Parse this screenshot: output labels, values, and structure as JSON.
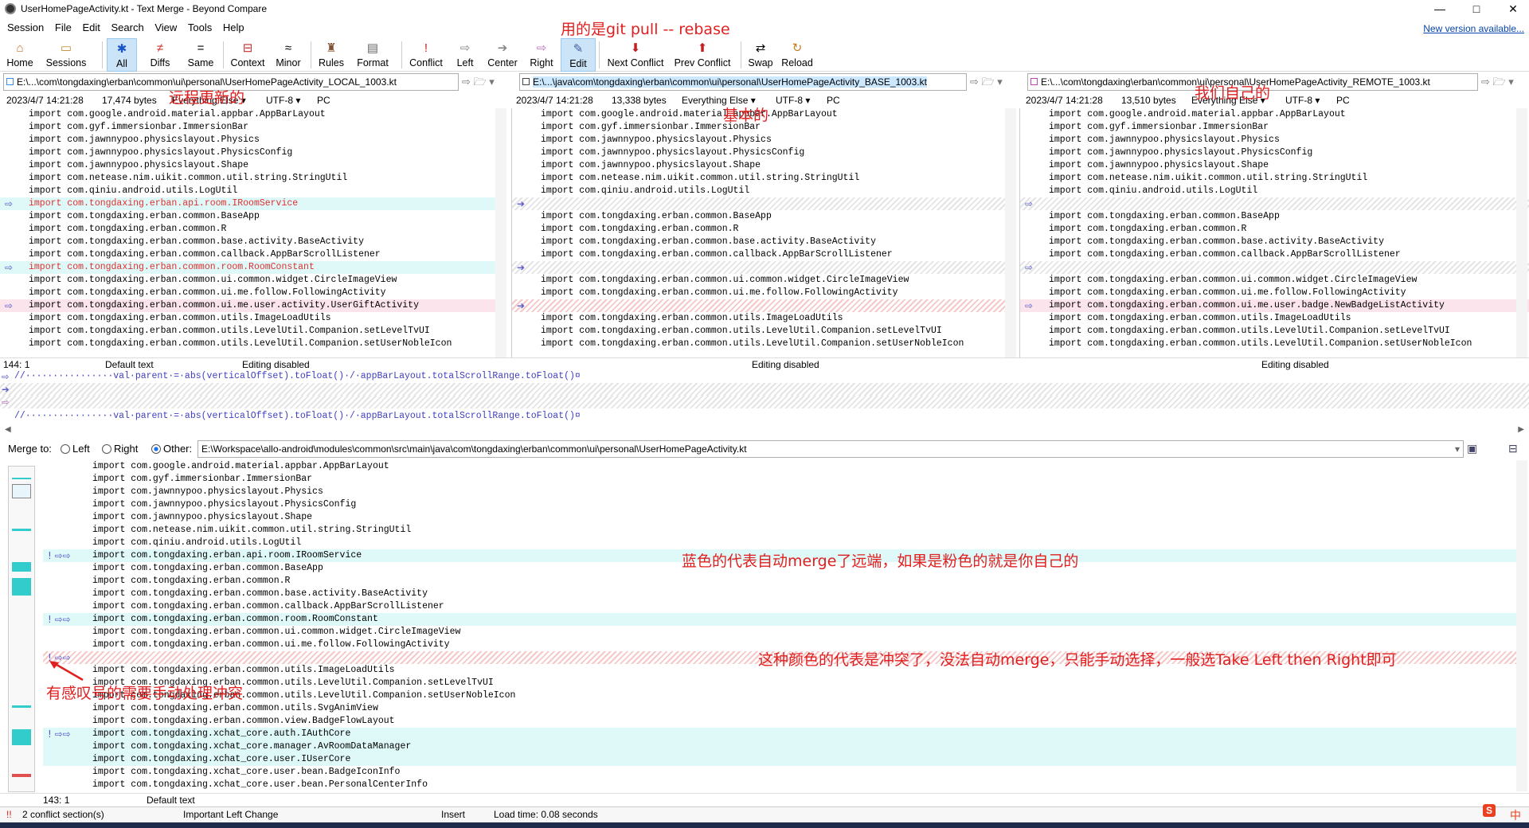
{
  "window": {
    "title": "UserHomePageActivity.kt - Text Merge - Beyond Compare",
    "minimize": "—",
    "maximize": "□",
    "close": "✕"
  },
  "menu": [
    "Session",
    "File",
    "Edit",
    "Search",
    "View",
    "Tools",
    "Help"
  ],
  "new_version": "New version available...",
  "toolbar": {
    "home": "Home",
    "sessions": "Sessions",
    "all": "All",
    "diffs": "Diffs",
    "same": "Same",
    "context": "Context",
    "minor": "Minor",
    "rules": "Rules",
    "format": "Format",
    "conflict": "Conflict",
    "left": "Left",
    "center": "Center",
    "right": "Right",
    "edit": "Edit",
    "next_conflict": "Next Conflict",
    "prev_conflict": "Prev Conflict",
    "swap": "Swap",
    "reload": "Reload"
  },
  "panes": {
    "left": {
      "path": "E:\\...\\com\\tongdaxing\\erban\\common\\ui\\personal\\UserHomePageActivity_LOCAL_1003.kt",
      "date": "2023/4/7 14:21:28",
      "size": "17,474 bytes",
      "format": "Everything Else",
      "encoding": "UTF-8",
      "lineend": "PC",
      "pos": "144: 1",
      "mode": "Default text",
      "edit": "Editing disabled"
    },
    "center": {
      "path": "E:\\...\\java\\com\\tongdaxing\\erban\\common\\ui\\personal\\UserHomePageActivity_BASE_1003.kt",
      "date": "2023/4/7 14:21:28",
      "size": "13,338 bytes",
      "format": "Everything Else",
      "encoding": "UTF-8",
      "lineend": "PC",
      "edit": "Editing disabled"
    },
    "right": {
      "path": "E:\\...\\com\\tongdaxing\\erban\\common\\ui\\personal\\UserHomePageActivity_REMOTE_1003.kt",
      "date": "2023/4/7 14:21:28",
      "size": "13,510 bytes",
      "format": "Everything Else",
      "encoding": "UTF-8",
      "lineend": "PC",
      "edit": "Editing disabled"
    }
  },
  "left_lines": [
    {
      "t": "import com.google.android.material.appbar.AppBarLayout"
    },
    {
      "t": "import com.gyf.immersionbar.ImmersionBar"
    },
    {
      "t": "import com.jawnnypoo.physicslayout.Physics"
    },
    {
      "t": "import com.jawnnypoo.physicslayout.PhysicsConfig"
    },
    {
      "t": "import com.jawnnypoo.physicslayout.Shape"
    },
    {
      "t": "import com.netease.nim.uikit.common.util.string.StringUtil"
    },
    {
      "t": "import com.qiniu.android.utils.LogUtil"
    },
    {
      "t": "import com.tongdaxing.erban.api.room.IRoomService",
      "cls": "hl-blue red",
      "ar": "⇨"
    },
    {
      "t": "import com.tongdaxing.erban.common.BaseApp"
    },
    {
      "t": "import com.tongdaxing.erban.common.R"
    },
    {
      "t": "import com.tongdaxing.erban.common.base.activity.BaseActivity"
    },
    {
      "t": "import com.tongdaxing.erban.common.callback.AppBarScrollListener"
    },
    {
      "t": "import com.tongdaxing.erban.common.room.RoomConstant",
      "cls": "hl-blue red",
      "ar": "⇨"
    },
    {
      "t": "import com.tongdaxing.erban.common.ui.common.widget.CircleImageView"
    },
    {
      "t": "import com.tongdaxing.erban.common.ui.me.follow.FollowingActivity"
    },
    {
      "t": "import com.tongdaxing.erban.common.ui.me.user.activity.UserGiftActivity",
      "cls": "hl-pink",
      "ar": "⇨"
    },
    {
      "t": "import com.tongdaxing.erban.common.utils.ImageLoadUtils"
    },
    {
      "t": "import com.tongdaxing.erban.common.utils.LevelUtil.Companion.setLevelTvUI"
    },
    {
      "t": "import com.tongdaxing.erban.common.utils.LevelUtil.Companion.setUserNobleIcon"
    }
  ],
  "center_lines": [
    {
      "t": "import com.google.android.material.appbar.AppBarLayout"
    },
    {
      "t": "import com.gyf.immersionbar.ImmersionBar"
    },
    {
      "t": "import com.jawnnypoo.physicslayout.Physics"
    },
    {
      "t": "import com.jawnnypoo.physicslayout.PhysicsConfig"
    },
    {
      "t": "import com.jawnnypoo.physicslayout.Shape"
    },
    {
      "t": "import com.netease.nim.uikit.common.util.string.StringUtil"
    },
    {
      "t": "import com.qiniu.android.utils.LogUtil"
    },
    {
      "t": "",
      "cls": "hatch",
      "ar": "➔"
    },
    {
      "t": "import com.tongdaxing.erban.common.BaseApp"
    },
    {
      "t": "import com.tongdaxing.erban.common.R"
    },
    {
      "t": "import com.tongdaxing.erban.common.base.activity.BaseActivity"
    },
    {
      "t": "import com.tongdaxing.erban.common.callback.AppBarScrollListener"
    },
    {
      "t": "",
      "cls": "hatch",
      "ar": "➔"
    },
    {
      "t": "import com.tongdaxing.erban.common.ui.common.widget.CircleImageView"
    },
    {
      "t": "import com.tongdaxing.erban.common.ui.me.follow.FollowingActivity"
    },
    {
      "t": "",
      "cls": "hatch-red",
      "ar": "➔"
    },
    {
      "t": "import com.tongdaxing.erban.common.utils.ImageLoadUtils"
    },
    {
      "t": "import com.tongdaxing.erban.common.utils.LevelUtil.Companion.setLevelTvUI"
    },
    {
      "t": "import com.tongdaxing.erban.common.utils.LevelUtil.Companion.setUserNobleIcon"
    }
  ],
  "right_lines": [
    {
      "t": "import com.google.android.material.appbar.AppBarLayout"
    },
    {
      "t": "import com.gyf.immersionbar.ImmersionBar"
    },
    {
      "t": "import com.jawnnypoo.physicslayout.Physics"
    },
    {
      "t": "import com.jawnnypoo.physicslayout.PhysicsConfig"
    },
    {
      "t": "import com.jawnnypoo.physicslayout.Shape"
    },
    {
      "t": "import com.netease.nim.uikit.common.util.string.StringUtil"
    },
    {
      "t": "import com.qiniu.android.utils.LogUtil"
    },
    {
      "t": "",
      "cls": "hatch",
      "ar": "⇨"
    },
    {
      "t": "import com.tongdaxing.erban.common.BaseApp"
    },
    {
      "t": "import com.tongdaxing.erban.common.R"
    },
    {
      "t": "import com.tongdaxing.erban.common.base.activity.BaseActivity"
    },
    {
      "t": "import com.tongdaxing.erban.common.callback.AppBarScrollListener"
    },
    {
      "t": "",
      "cls": "hatch",
      "ar": "⇨"
    },
    {
      "t": "import com.tongdaxing.erban.common.ui.common.widget.CircleImageView"
    },
    {
      "t": "import com.tongdaxing.erban.common.ui.me.follow.FollowingActivity"
    },
    {
      "t": "import com.tongdaxing.erban.common.ui.me.user.badge.NewBadgeListActivity",
      "cls": "hl-pink",
      "ar": "⇨"
    },
    {
      "t": "import com.tongdaxing.erban.common.utils.ImageLoadUtils"
    },
    {
      "t": "import com.tongdaxing.erban.common.utils.LevelUtil.Companion.setLevelTvUI"
    },
    {
      "t": "import com.tongdaxing.erban.common.utils.LevelUtil.Companion.setUserNobleIcon"
    }
  ],
  "diff_rows": [
    "//················val·parent·=·abs(verticalOffset).toFloat()·/·appBarLayout.totalScrollRange.toFloat()¤",
    "",
    "",
    "//················val·parent·=·abs(verticalOffset).toFloat()·/·appBarLayout.totalScrollRange.toFloat()¤"
  ],
  "merge": {
    "label": "Merge to:",
    "left": "Left",
    "right": "Right",
    "other": "Other:",
    "path": "E:\\Workspace\\allo-android\\modules\\common\\src\\main\\java\\com\\tongdaxing\\erban\\common\\ui\\personal\\UserHomePageActivity.kt"
  },
  "output_lines": [
    {
      "t": "import com.google.android.material.appbar.AppBarLayout"
    },
    {
      "t": "import com.gyf.immersionbar.ImmersionBar"
    },
    {
      "t": "import com.jawnnypoo.physicslayout.Physics"
    },
    {
      "t": "import com.jawnnypoo.physicslayout.PhysicsConfig"
    },
    {
      "t": "import com.jawnnypoo.physicslayout.Shape"
    },
    {
      "t": "import com.netease.nim.uikit.common.util.string.StringUtil"
    },
    {
      "t": "import com.qiniu.android.utils.LogUtil"
    },
    {
      "t": "import com.tongdaxing.erban.api.room.IRoomService",
      "cls": "hl-blue",
      "mk": "! ⇨⇨"
    },
    {
      "t": "import com.tongdaxing.erban.common.BaseApp"
    },
    {
      "t": "import com.tongdaxing.erban.common.R"
    },
    {
      "t": "import com.tongdaxing.erban.common.base.activity.BaseActivity"
    },
    {
      "t": "import com.tongdaxing.erban.common.callback.AppBarScrollListener"
    },
    {
      "t": "import com.tongdaxing.erban.common.room.RoomConstant",
      "cls": "hl-blue",
      "mk": "! ⇨⇨"
    },
    {
      "t": "import com.tongdaxing.erban.common.ui.common.widget.CircleImageView"
    },
    {
      "t": "import com.tongdaxing.erban.common.ui.me.follow.FollowingActivity"
    },
    {
      "t": "",
      "cls": "hatch-red",
      "mk": "! ⇨⇨"
    },
    {
      "t": "import com.tongdaxing.erban.common.utils.ImageLoadUtils"
    },
    {
      "t": "import com.tongdaxing.erban.common.utils.LevelUtil.Companion.setLevelTvUI"
    },
    {
      "t": "import com.tongdaxing.erban.common.utils.LevelUtil.Companion.setUserNobleIcon"
    },
    {
      "t": "import com.tongdaxing.erban.common.utils.SvgAnimView"
    },
    {
      "t": "import com.tongdaxing.erban.common.view.BadgeFlowLayout"
    },
    {
      "t": "import com.tongdaxing.xchat_core.auth.IAuthCore",
      "cls": "hl-blue",
      "mk": "! ⇨⇨"
    },
    {
      "t": "import com.tongdaxing.xchat_core.manager.AvRoomDataManager",
      "cls": "hl-blue"
    },
    {
      "t": "import com.tongdaxing.xchat_core.user.IUserCore",
      "cls": "hl-blue"
    },
    {
      "t": "import com.tongdaxing.xchat_core.user.bean.BadgeIconInfo"
    },
    {
      "t": "import com.tongdaxing.xchat_core.user.bean.PersonalCenterInfo"
    }
  ],
  "output_status": {
    "pos": "143: 1",
    "mode": "Default text"
  },
  "bottom": {
    "conflicts": "2 conflict section(s)",
    "change": "Important Left Change",
    "insert": "Insert",
    "load": "Load time: 0.08 seconds"
  },
  "annotations": {
    "top": "用的是git pull -- rebase",
    "remote": "远程更新的",
    "base": "基本的",
    "mine": "我们自己的",
    "blue": "蓝色的代表自动merge了远端，如果是粉色的就是你自己的",
    "conflict": "这种颜色的代表是冲突了，没法自动merge，只能手动选择，一般选Take Left then Right即可",
    "manual": "有感叹号的需要手动处理冲突"
  },
  "ime": "中"
}
